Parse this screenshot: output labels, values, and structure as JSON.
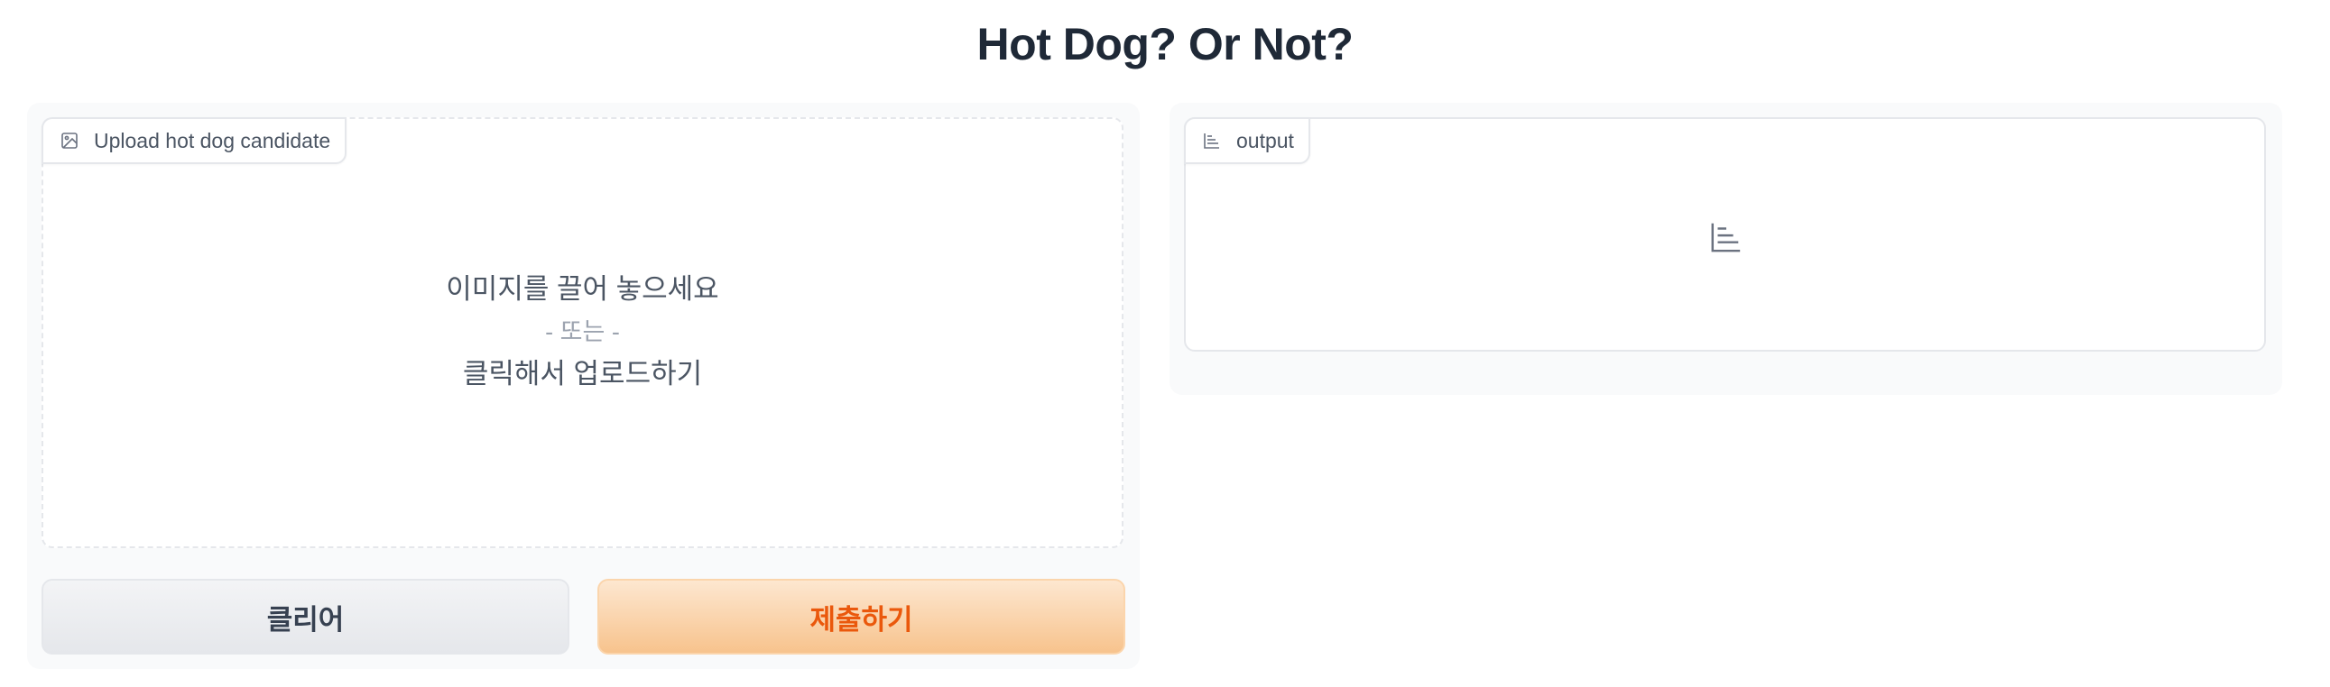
{
  "app": {
    "title": "Hot Dog? Or Not?"
  },
  "input_panel": {
    "label": "Upload hot dog candidate",
    "label_icon": "image-icon",
    "drop_text": "이미지를 끌어 놓으세요",
    "or_text": "- 또는 -",
    "click_text": "클릭해서 업로드하기"
  },
  "output_panel": {
    "label": "output",
    "label_icon": "bar-chart-icon",
    "placeholder_icon": "bar-chart-icon"
  },
  "buttons": {
    "clear_label": "클리어",
    "submit_label": "제출하기"
  },
  "colors": {
    "accent": "#ea580c",
    "submit_bg_top": "#fde7d0",
    "submit_bg_bottom": "#f7c38d",
    "panel_bg": "#f9fafb",
    "border": "#e5e7eb"
  }
}
